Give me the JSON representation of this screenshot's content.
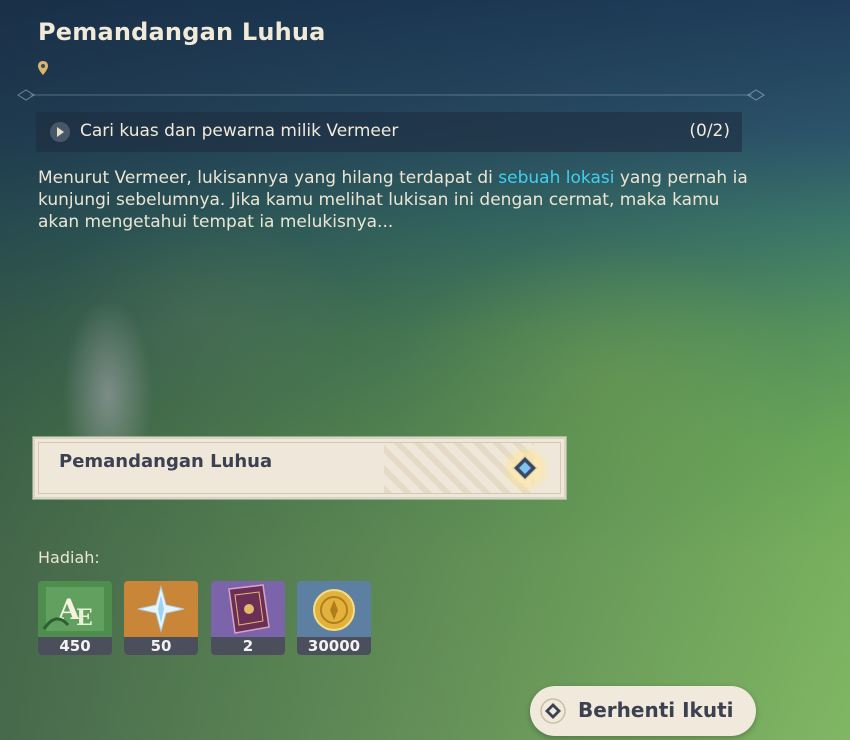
{
  "quest": {
    "title": "Pemandangan Luhua",
    "pin_icon": "location-pin-icon",
    "objective": {
      "text": "Cari kuas dan pewarna milik Vermeer",
      "progress": "(0/2)"
    },
    "description": {
      "before": "Menurut Vermeer, lukisannya yang hilang terdapat di ",
      "highlight": "sebuah lokasi",
      "after": " yang pernah ia kunjungi sebelumnya. Jika kamu melihat lukisan ini dengan cermat, maka kamu akan mengetahui tempat ia melukisnya..."
    },
    "location_card": {
      "label": "Pemandangan Luhua",
      "icon": "waypoint-diamond-icon"
    },
    "rewards": {
      "label": "Hadiah:",
      "items": [
        {
          "name": "adventure-exp-icon",
          "count": "450"
        },
        {
          "name": "primogem-icon",
          "count": "50"
        },
        {
          "name": "heros-wit-book-icon",
          "count": "2"
        },
        {
          "name": "mora-coin-icon",
          "count": "30000"
        }
      ]
    },
    "stop_button": {
      "label": "Berhenti Ikuti",
      "icon": "diamond-icon"
    }
  },
  "colors": {
    "highlight": "#3fd0f0",
    "card_bg": "#efe8da",
    "text_light": "#f1ead8",
    "text_dark": "#3b4151"
  }
}
